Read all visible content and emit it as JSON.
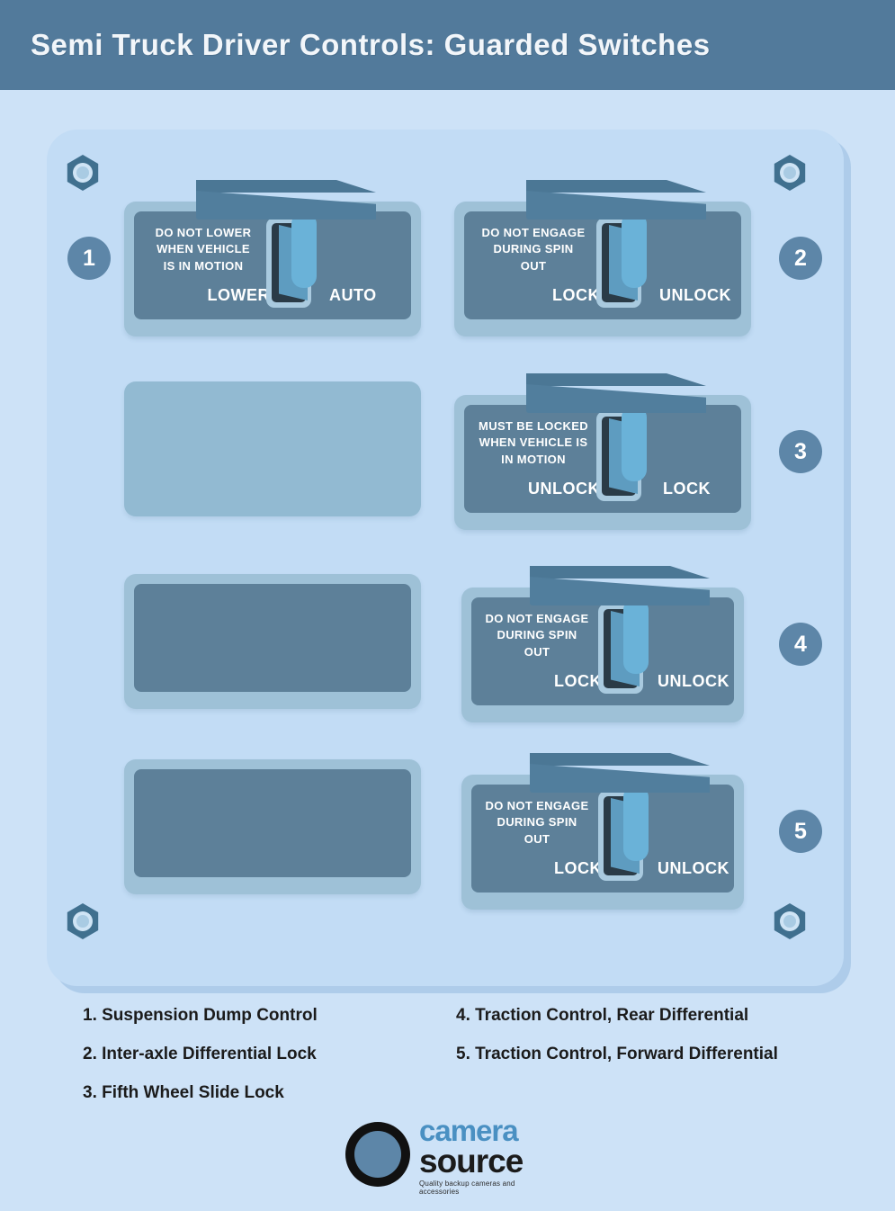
{
  "header": {
    "title": "Semi Truck Driver Controls: Guarded Switches"
  },
  "colors": {
    "page_background": "#cde2f7",
    "header_background": "#527a9b",
    "board": "#c2dcf5",
    "panel_frame": "#9ec1d7",
    "panel_inner": "#5d8099",
    "badge": "#5d86a8",
    "guard": "#517e9d",
    "toggle_lever": "#6ab2d8",
    "legend_text": "#1b1b1b",
    "logo_camera": "#4a90c2",
    "logo_source": "#1b1b1b"
  },
  "board": {
    "bolts": [
      {
        "name": "bolt-top-left"
      },
      {
        "name": "bolt-top-right"
      },
      {
        "name": "bolt-bottom-left"
      },
      {
        "name": "bolt-bottom-right"
      }
    ]
  },
  "switches": [
    {
      "number": "1",
      "warning": "DO NOT LOWER\nWHEN VEHICLE\nIS IN MOTION",
      "left_label": "LOWER",
      "right_label": "AUTO",
      "badge_side": "left"
    },
    {
      "number": "2",
      "warning": "DO NOT ENGAGE\nDURING SPIN\nOUT",
      "left_label": "LOCK",
      "right_label": "UNLOCK",
      "badge_side": "right"
    },
    {
      "number": "3",
      "warning": "MUST BE LOCKED\nWHEN VEHICLE IS\nIN MOTION",
      "left_label": "UNLOCK",
      "right_label": "LOCK",
      "badge_side": "right"
    },
    {
      "number": "4",
      "warning": "DO NOT ENGAGE\nDURING SPIN\nOUT",
      "left_label": "LOCK",
      "right_label": "UNLOCK",
      "badge_side": "right"
    },
    {
      "number": "5",
      "warning": "DO NOT ENGAGE\nDURING SPIN\nOUT",
      "left_label": "LOCK",
      "right_label": "UNLOCK",
      "badge_side": "right"
    }
  ],
  "blank_panels": [
    {
      "name": "blank-panel-row2",
      "style": "plain"
    },
    {
      "name": "blank-panel-row3",
      "style": "framed"
    },
    {
      "name": "blank-panel-row4",
      "style": "framed"
    }
  ],
  "legend": {
    "left_column": [
      "1. Suspension Dump Control",
      "2. Inter-axle Differential Lock",
      "3. Fifth Wheel Slide Lock"
    ],
    "right_column": [
      "4. Traction Control, Rear Differential",
      "5. Traction Control, Forward Differential"
    ]
  },
  "logo": {
    "word_one": "camera",
    "word_two": "source",
    "tagline": "Quality backup cameras and accessories"
  }
}
